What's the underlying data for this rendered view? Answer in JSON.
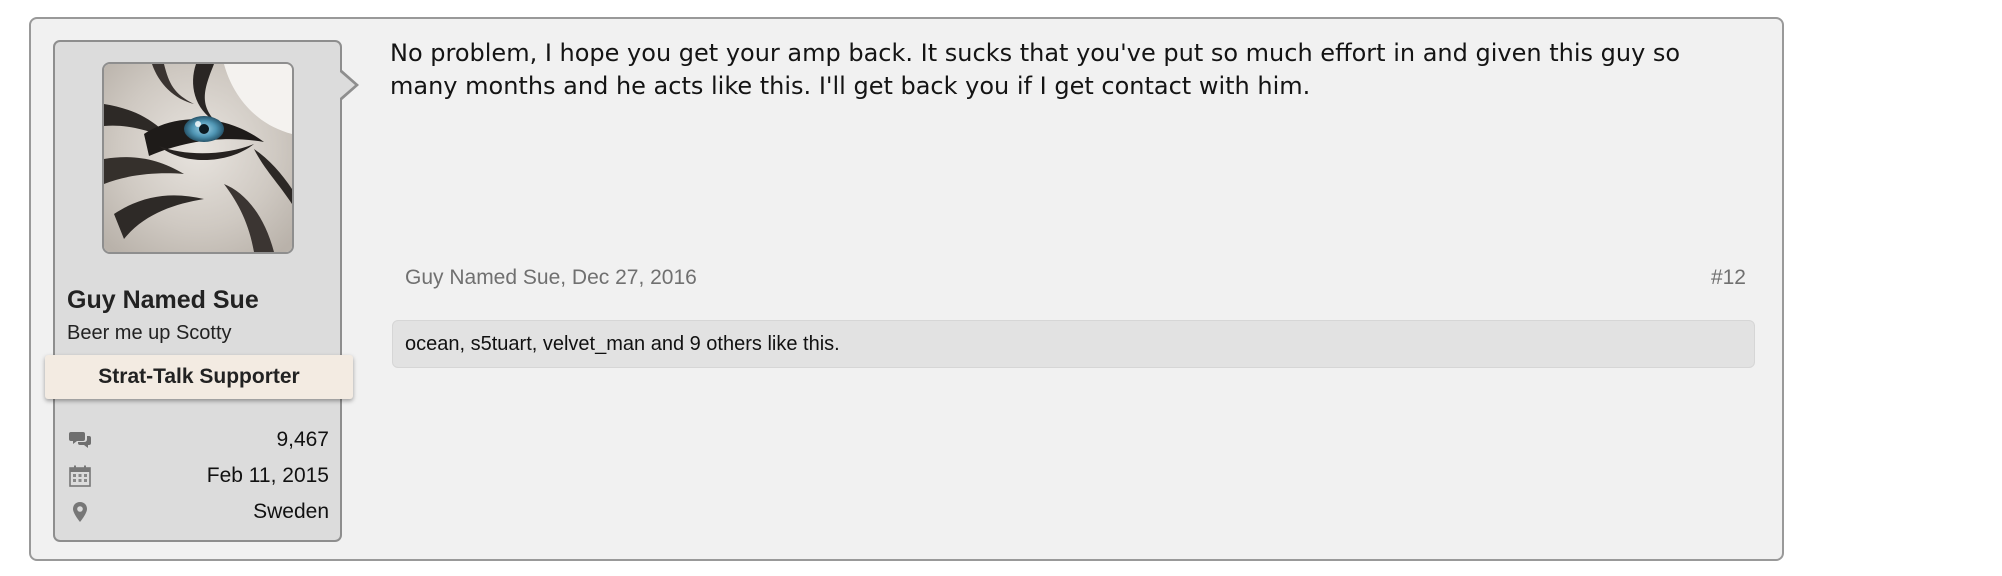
{
  "post": {
    "author": {
      "name": "Guy Named Sue",
      "title": "Beer me up Scotty",
      "banner": "Strat-Talk Supporter",
      "avatar_icon": "tiger-eye-avatar",
      "stats": {
        "messages": {
          "icon": "speech-bubbles-icon",
          "value": "9,467"
        },
        "joined": {
          "icon": "calendar-icon",
          "value": "Feb 11, 2015"
        },
        "location": {
          "icon": "map-marker-icon",
          "value": "Sweden"
        }
      }
    },
    "message": "No problem, I hope you get your amp back. It sucks that you've put so much effort in and given this guy so many months and he acts like this. I'll get back you if I get contact with him.",
    "meta": {
      "author_date": "Guy Named Sue, Dec 27, 2016",
      "post_number": "#12"
    },
    "likes": "ocean, s5tuart, velvet_man and 9 others like this."
  },
  "colors": {
    "post_background": "#f1f1f1",
    "panel_background": "#dcdcdc",
    "border": "#8e8e8e",
    "banner_background": "#f3ebe2",
    "meta_text": "#707070",
    "likes_background": "#e2e2e2"
  }
}
